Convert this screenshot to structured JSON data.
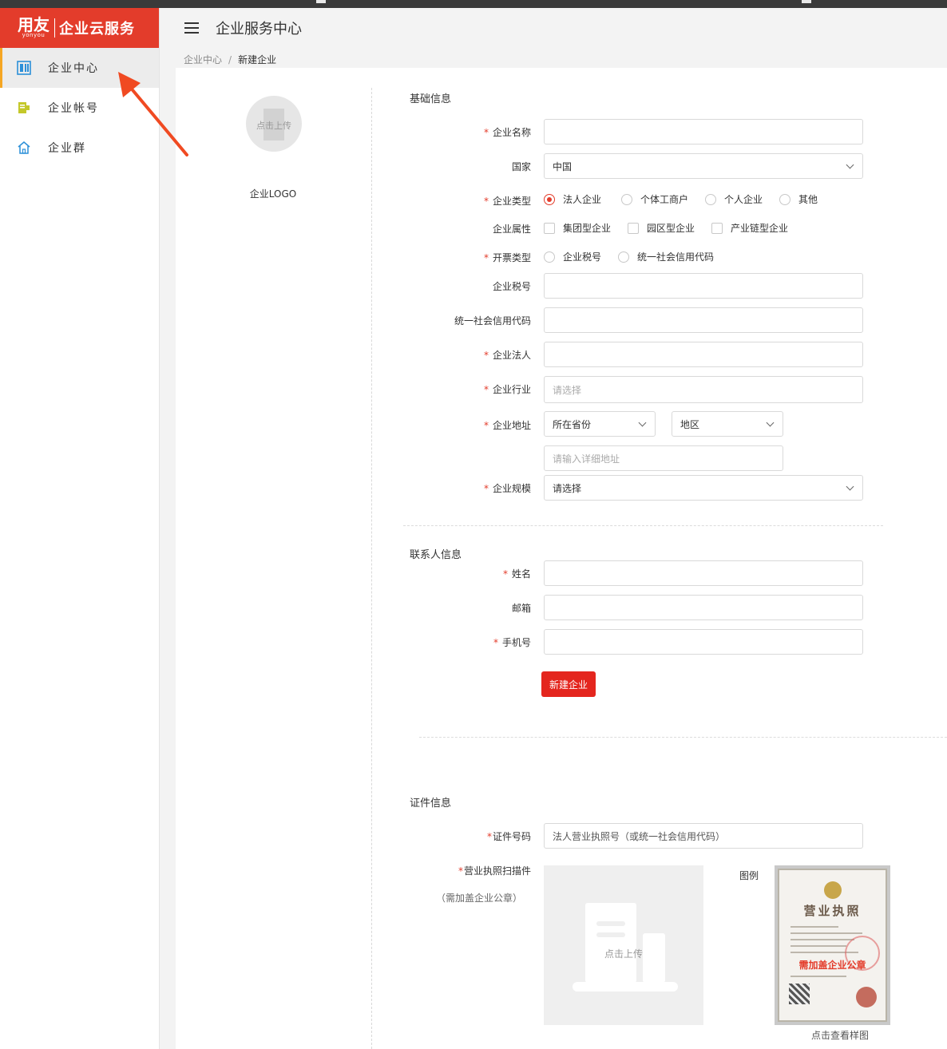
{
  "app": {
    "brand_cn": "用友",
    "brand_en": "yonyou",
    "service_name": "企业云服务",
    "header_title": "企业服务中心"
  },
  "sidebar": {
    "items": [
      {
        "label": "企业中心",
        "icon": "enterprise-center-icon",
        "active": true
      },
      {
        "label": "企业帐号",
        "icon": "enterprise-account-icon",
        "active": false
      },
      {
        "label": "企业群",
        "icon": "home-icon",
        "active": false
      }
    ]
  },
  "breadcrumb": {
    "parent": "企业中心",
    "separator": "/",
    "current": "新建企业"
  },
  "logo_upload": {
    "button_text": "点击上传",
    "label": "企业LOGO"
  },
  "basic_info": {
    "title": "基础信息",
    "company_name": {
      "label": "企业名称",
      "value": ""
    },
    "country": {
      "label": "国家",
      "value": "中国"
    },
    "company_type": {
      "label": "企业类型",
      "options": [
        "法人企业",
        "个体工商户",
        "个人企业",
        "其他"
      ],
      "selected": "法人企业"
    },
    "company_attr": {
      "label": "企业属性",
      "options": [
        "集团型企业",
        "园区型企业",
        "产业链型企业"
      ]
    },
    "invoice_type": {
      "label": "开票类型",
      "options": [
        "企业税号",
        "统一社会信用代码"
      ]
    },
    "tax_no": {
      "label": "企业税号",
      "value": ""
    },
    "credit_code": {
      "label": "统一社会信用代码",
      "value": ""
    },
    "legal_person": {
      "label": "企业法人",
      "value": ""
    },
    "industry": {
      "label": "企业行业",
      "placeholder": "请选择"
    },
    "address": {
      "label": "企业地址",
      "province": "所在省份",
      "region": "地区",
      "detail_placeholder": "请输入详细地址"
    },
    "scale": {
      "label": "企业规模",
      "value": "请选择"
    }
  },
  "contact_info": {
    "title": "联系人信息",
    "name": {
      "label": "姓名",
      "value": ""
    },
    "email": {
      "label": "邮箱",
      "value": ""
    },
    "phone": {
      "label": "手机号",
      "value": ""
    },
    "submit_label": "新建企业"
  },
  "certificate_info": {
    "title": "证件信息",
    "cert_no": {
      "label": "证件号码",
      "placeholder": "法人营业执照号（或统一社会信用代码）"
    },
    "scan": {
      "label": "营业执照扫描件",
      "note": "（需加盖企业公章）",
      "upload_text": "点击上传"
    },
    "example": {
      "label": "图例",
      "cert_title": "营业执照",
      "stamp_note": "需加盖企业公章",
      "caption": "点击查看样图"
    }
  },
  "colors": {
    "brand_red": "#e33c2b",
    "button_red": "#e4261e",
    "active_indicator": "#f5a623",
    "annotation_arrow": "#f04a22"
  }
}
